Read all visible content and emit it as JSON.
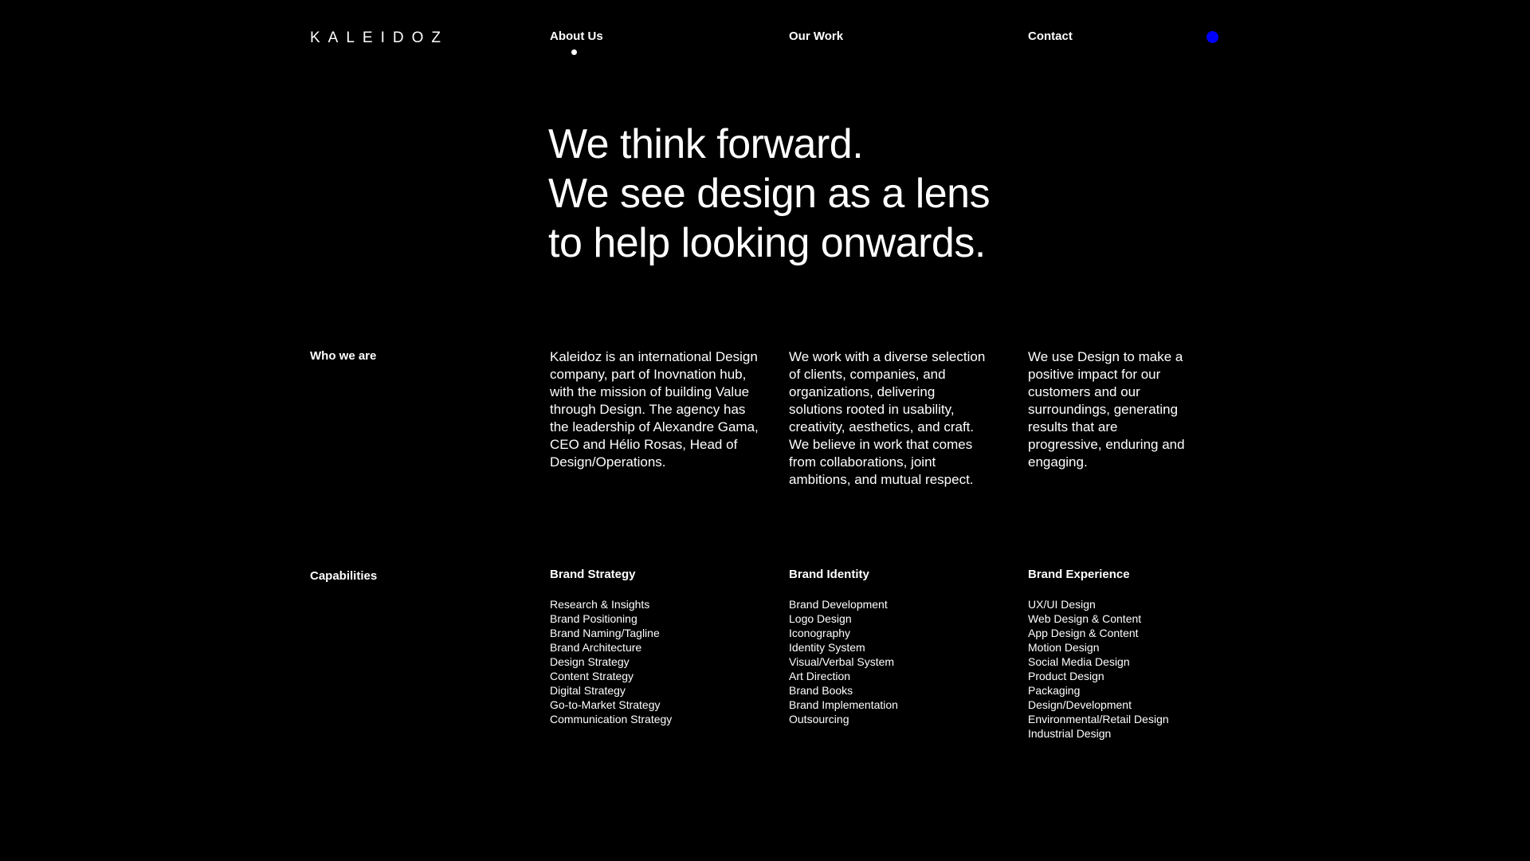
{
  "header": {
    "logo": "KALEIDOZ",
    "nav": {
      "about": "About Us",
      "work": "Our Work",
      "contact": "Contact"
    },
    "accent_color": "#0000ff"
  },
  "hero": {
    "line1": "We think forward.",
    "line2": "We see design as a lens",
    "line3": "to help looking onwards."
  },
  "who_we_are": {
    "label": "Who we are",
    "paragraphs": [
      "Kaleidoz is an international Design company, part of Inovnation hub, with the mission of building Value through Design. The agency has the leadership of Alexandre Gama, CEO and Hélio Rosas, Head of Design/Operations.",
      "We work with a diverse selection of clients, companies, and organizations, delivering solutions rooted in usability, creativity, aesthetics, and craft. We believe in work that comes from collaborations, joint ambitions, and mutual respect.",
      "We use Design to make a positive impact for our customers and our surroundings, generating results that are progressive, enduring and engaging."
    ]
  },
  "capabilities": {
    "label": "Capabilities",
    "columns": [
      {
        "title": "Brand Strategy",
        "items": [
          "Research & Insights",
          "Brand Positioning",
          "Brand Naming/Tagline",
          "Brand Architecture",
          "Design Strategy",
          "Content Strategy",
          "Digital Strategy",
          "Go-to-Market Strategy",
          "Communication Strategy"
        ]
      },
      {
        "title": "Brand Identity",
        "items": [
          "Brand Development",
          "Logo Design",
          "Iconography",
          "Identity System",
          "Visual/Verbal System",
          "Art Direction",
          "Brand Books",
          "Brand Implementation",
          "Outsourcing"
        ]
      },
      {
        "title": "Brand Experience",
        "items": [
          "UX/UI Design",
          "Web Design & Content",
          "App Design & Content",
          "Motion Design",
          "Social Media Design",
          "Product Design",
          "Packaging",
          "Design/Development",
          "Environmental/Retail Design",
          "Industrial Design"
        ]
      }
    ]
  }
}
